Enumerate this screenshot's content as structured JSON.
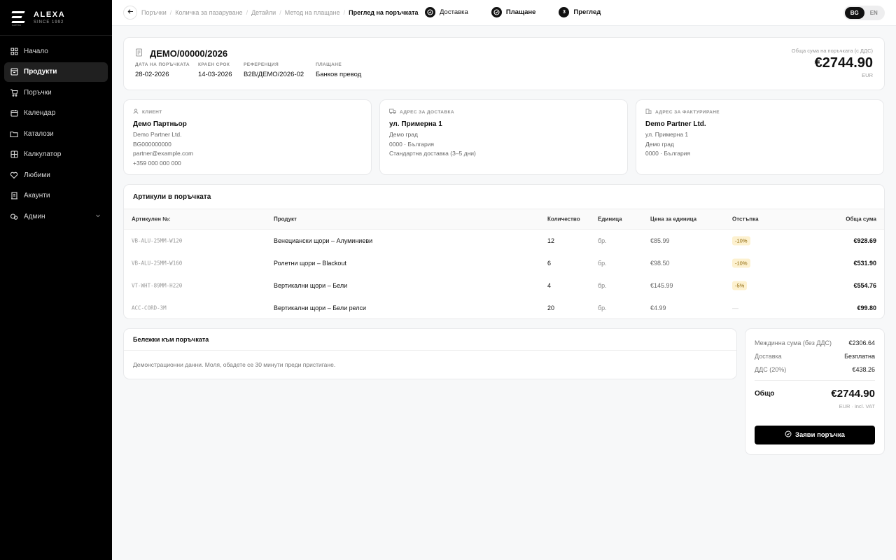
{
  "brand": {
    "name": "ALEXA",
    "since": "SINCE 1992",
    "tiny": "ALEXA"
  },
  "sidebar": {
    "items": [
      {
        "label": "Начало",
        "icon": "grid-icon"
      },
      {
        "label": "Продукти",
        "icon": "box-icon",
        "active": true
      },
      {
        "label": "Поръчки",
        "icon": "cart-icon"
      },
      {
        "label": "Календар",
        "icon": "calendar-icon"
      },
      {
        "label": "Каталози",
        "icon": "folder-icon"
      },
      {
        "label": "Калкулатор",
        "icon": "calculator-icon"
      },
      {
        "label": "Любими",
        "icon": "heart-icon"
      },
      {
        "label": "Акаунти",
        "icon": "building-icon"
      },
      {
        "label": "Админ",
        "icon": "admin-icon"
      }
    ]
  },
  "topbar": {
    "breadcrumbs": [
      "Поръчки",
      "Количка за пазаруване",
      "Детайли",
      "Метод на плащане",
      "Преглед на поръчката"
    ],
    "steps": [
      {
        "label": "Доставка",
        "marker": ""
      },
      {
        "label": "Плащане",
        "marker": ""
      },
      {
        "label": "Преглед",
        "marker": "3"
      }
    ],
    "lang": {
      "bg": "BG",
      "en": "EN"
    }
  },
  "order": {
    "number": "ДЕМО/00000/2026",
    "date_label": "ДАТА НА ПОРЪЧКАТА",
    "date": "28-02-2026",
    "deadline_label": "КРАЕН СРОК",
    "deadline": "14-03-2026",
    "ref_label": "РЕФЕРЕНЦИЯ",
    "ref": "B2B/ДЕМО/2026-02",
    "payment_label": "ПЛАЩАНЕ",
    "payment": "Банков превод",
    "total_label": "Обща сума на поръчката (с ДДС)",
    "total": "€2744.90",
    "currency": "EUR"
  },
  "client": {
    "title": "КЛИЕНТ",
    "name": "Демо Партньор",
    "lines": [
      "Demo Partner Ltd.",
      "BG000000000",
      "partner@example.com",
      "+359 000 000 000"
    ]
  },
  "shipping": {
    "title": "АДРЕС ЗА ДОСТАВКА",
    "name": "ул. Примерна 1",
    "lines": [
      "Демо град",
      "0000 · България",
      "Стандартна доставка (3–5 дни)"
    ]
  },
  "billing": {
    "title": "АДРЕС ЗА ФАКТУРИРАНЕ",
    "name": "Demo Partner Ltd.",
    "lines": [
      "ул. Примерна 1",
      "Демо град",
      "0000 · България"
    ]
  },
  "items": {
    "title": "Артикули в поръчката",
    "headers": {
      "sku": "Артикулен №:",
      "product": "Продукт",
      "qty": "Количество",
      "unit": "Единица",
      "price": "Цена за единица",
      "discount": "Отстъпка",
      "total": "Обща сума"
    },
    "rows": [
      {
        "sku": "VB-ALU-25MM-W120",
        "product": "Венециански щори – Алуминиеви",
        "qty": "12",
        "unit": "бр.",
        "price": "€85.99",
        "discount": "-10%",
        "total": "€928.69"
      },
      {
        "sku": "VB-ALU-25MM-W160",
        "product": "Ролетни щори – Blackout",
        "qty": "6",
        "unit": "бр.",
        "price": "€98.50",
        "discount": "-10%",
        "total": "€531.90"
      },
      {
        "sku": "VT-WHT-89MM-H220",
        "product": "Вертикални щори – Бели",
        "qty": "4",
        "unit": "бр.",
        "price": "€145.99",
        "discount": "-5%",
        "total": "€554.76"
      },
      {
        "sku": "ACC-CORD-3M",
        "product": "Вертикални щори – Бели релси",
        "qty": "20",
        "unit": "бр.",
        "price": "€4.99",
        "discount": "—",
        "total": "€99.80"
      }
    ]
  },
  "notes": {
    "title": "Бележки към поръчката",
    "text": "Демонстрационни данни. Моля, обадете се 30 минути преди пристигане."
  },
  "summary": {
    "subtotal_label": "Междинна сума (без ДДС)",
    "subtotal": "€2306.64",
    "delivery_label": "Доставка",
    "delivery": "Безплатна",
    "vat_label": "ДДС (20%)",
    "vat": "€438.26",
    "grand_label": "Общо",
    "grand": "€2744.90",
    "grand_sub": "EUR · incl. VAT",
    "submit": "Заяви поръчка"
  },
  "colors": {
    "sidebar_bg": "#000000",
    "accent": "#111111",
    "discount_bg": "#fdf1cf",
    "discount_text": "#8a6200"
  }
}
